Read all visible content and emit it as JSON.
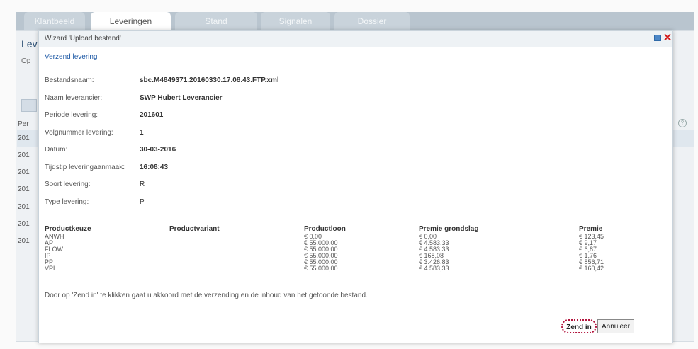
{
  "tabs": [
    {
      "label": "Klantbeeld",
      "active": false
    },
    {
      "label": "Leveringen",
      "active": true
    },
    {
      "label": "Stand",
      "active": false
    },
    {
      "label": "Signalen",
      "active": false
    },
    {
      "label": "Dossier",
      "active": false
    }
  ],
  "background": {
    "page_title_partial": "Lev",
    "op_text_partial": "Op",
    "column_header_partial": "Per",
    "row_values_partial": [
      "201",
      "201",
      "201",
      "201",
      "201",
      "201",
      "201"
    ]
  },
  "modal": {
    "title": "Wizard 'Upload bestand'",
    "subtitle": "Verzend levering",
    "fields": [
      {
        "label": "Bestandsnaam:",
        "value": "sbc.M4849371.20160330.17.08.43.FTP.xml"
      },
      {
        "label": "Naam leverancier:",
        "value": "SWP Hubert Leverancier"
      },
      {
        "label": "Periode levering:",
        "value": "201601"
      },
      {
        "label": "Volgnummer levering:",
        "value": "1"
      },
      {
        "label": "Datum:",
        "value": "30-03-2016"
      },
      {
        "label": "Tijdstip leveringaanmaak:",
        "value": "16:08:43"
      },
      {
        "label": "Soort levering:",
        "value": "R"
      },
      {
        "label": "Type levering:",
        "value": "P"
      }
    ],
    "table": {
      "headers": [
        "Productkeuze",
        "Productvariant",
        "Productloon",
        "Premie grondslag",
        "Premie"
      ],
      "rows": [
        [
          "ANWH",
          "",
          "€ 0,00",
          "€ 0,00",
          "€ 123,45"
        ],
        [
          "AP",
          "",
          "€ 55.000,00",
          "€ 4.583,33",
          "€ 9,17"
        ],
        [
          "FLOW",
          "",
          "€ 55.000,00",
          "€ 4.583,33",
          "€ 6,87"
        ],
        [
          "IP",
          "",
          "€ 55.000,00",
          "€ 168,08",
          "€ 1,76"
        ],
        [
          "PP",
          "",
          "€ 55.000,00",
          "€ 3.426,83",
          "€ 856,71"
        ],
        [
          "VPL",
          "",
          "€ 55.000,00",
          "€ 4.583,33",
          "€ 160,42"
        ]
      ]
    },
    "footer_note": "Door op 'Zend in' te klikken gaat u akkoord met de verzending en de inhoud van het getoonde bestand.",
    "buttons": {
      "send": "Zend in",
      "cancel": "Annuleer"
    },
    "icons": {
      "restore": "restore-window-icon",
      "close": "close-icon"
    },
    "colors": {
      "close": "#d42020",
      "link": "#1f5aa6",
      "highlight": "#b3163e"
    }
  }
}
